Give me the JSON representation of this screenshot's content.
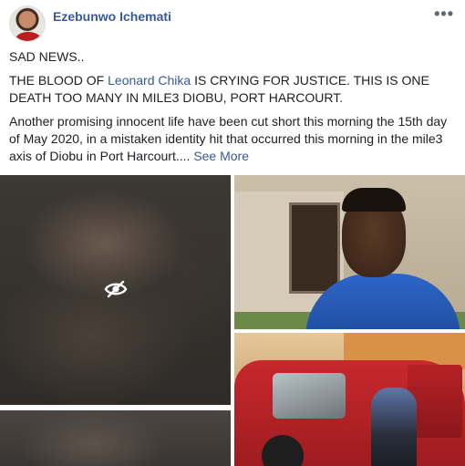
{
  "post": {
    "author": "Ezebunwo Ichemati",
    "more_icon": "more-horizontal-icon",
    "line1": "SAD NEWS..",
    "line2_pre": "THE BLOOD OF ",
    "line2_tag": "Leonard Chika",
    "line2_post": " IS CRYING FOR JUSTICE. THIS IS ONE DEATH TOO MANY IN MILE3 DIOBU, PORT HARCOURT.",
    "line3": "Another promising innocent life have been cut short this morning the 15th day of May 2020, in a mistaken identity hit that occurred this morning in the mile3 axis of Diobu in Port Harcourt....",
    "see_more": "See More"
  },
  "gallery": {
    "icons": [
      "eye-slash-icon"
    ],
    "photos": [
      "blurred-sensitive-photo",
      "man-portrait-photo",
      "damaged-red-car-photo",
      "blurred-sensitive-photo-2"
    ]
  },
  "colors": {
    "link": "#385898",
    "text": "#1c1e21"
  }
}
